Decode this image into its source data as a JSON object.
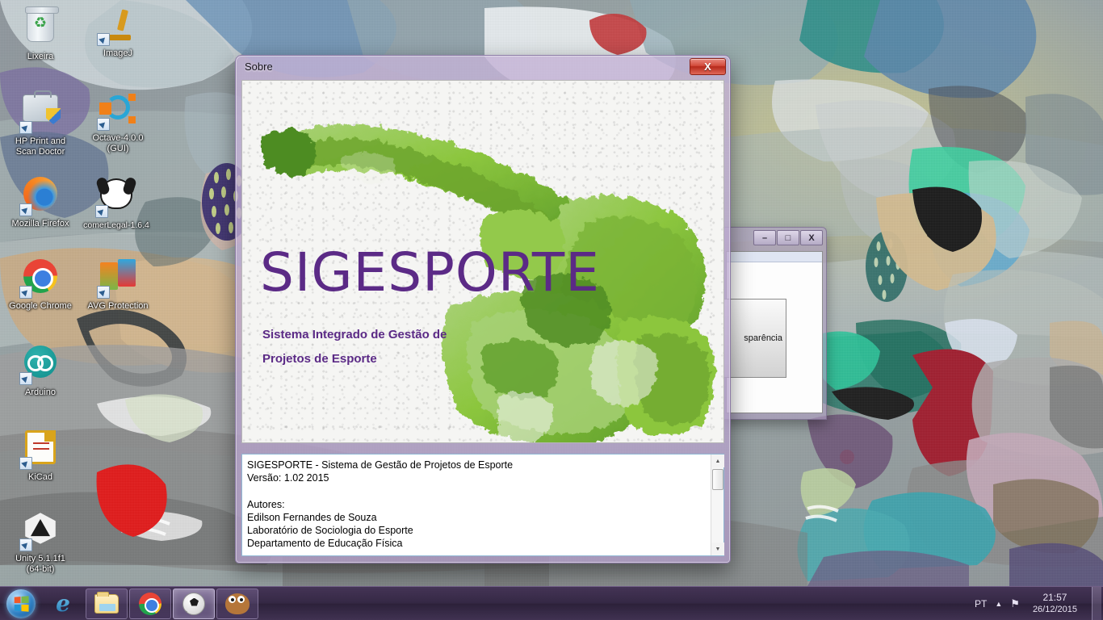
{
  "desktop": {
    "icons": [
      {
        "label": "Lixeira",
        "icon": "recycle-bin-icon"
      },
      {
        "label": "ImageJ",
        "icon": "microscope-icon"
      },
      {
        "label": "HP Print and\nScan Doctor",
        "icon": "hp-printer-icon"
      },
      {
        "label": "Octave-4.0.0\n(GUI)",
        "icon": "octave-icon"
      },
      {
        "label": "Mozilla Firefox",
        "icon": "firefox-icon"
      },
      {
        "label": "comerLegal-1.6.4",
        "icon": "dog-icon"
      },
      {
        "label": "Google Chrome",
        "icon": "chrome-icon"
      },
      {
        "label": "AVG Protection",
        "icon": "avg-icon"
      },
      {
        "label": "Arduino",
        "icon": "arduino-icon"
      },
      {
        "label": "KiCad",
        "icon": "kicad-icon"
      },
      {
        "label": "Unity 5.1.1f1\n(64-bit)",
        "icon": "unity-icon"
      }
    ]
  },
  "background_window": {
    "minimize_label": "–",
    "maximize_label": "□",
    "close_label": "X",
    "panel_text": "sparência"
  },
  "dialog": {
    "title": "Sobre",
    "close_label": "X",
    "splash": {
      "logo_text": "SIGESPORTE",
      "tagline": "Sistema Integrado de Gestão de Projetos de Esporte",
      "logo_color": "#5b2a86",
      "figure_color": "#8cc63e"
    },
    "info_text": "SIGESPORTE - Sistema de Gestão de Projetos de Esporte\nVersão: 1.02 2015\n\nAutores:\nEdilson Fernandes de Souza\nLaboratório de Sociologia do Esporte\nDepartamento de Educação Física",
    "scrollbar": {
      "up_arrow": "▲",
      "down_arrow": "▼"
    }
  },
  "taskbar": {
    "start_label": "Start",
    "items": [
      {
        "name": "internet-explorer",
        "label": "e",
        "state": "pinned"
      },
      {
        "name": "windows-explorer",
        "label": "",
        "state": "framed"
      },
      {
        "name": "google-chrome",
        "label": "",
        "state": "framed"
      },
      {
        "name": "sigesporte",
        "label": "",
        "state": "active"
      },
      {
        "name": "gimp",
        "label": "",
        "state": "framed"
      }
    ],
    "tray": {
      "language": "PT",
      "chevron": "▲",
      "flag": "⚑",
      "time": "21:57",
      "date": "26/12/2015"
    }
  }
}
